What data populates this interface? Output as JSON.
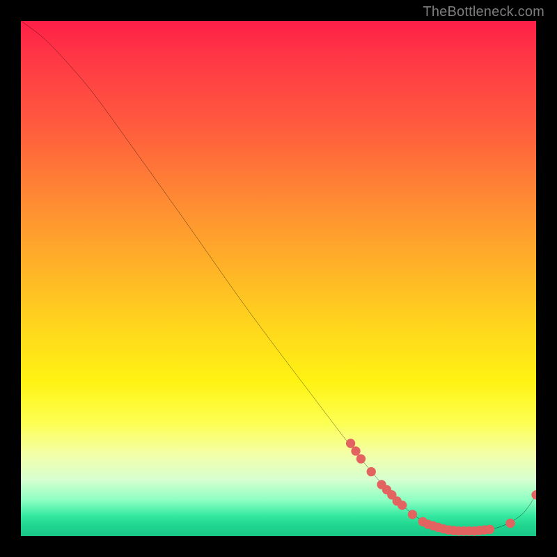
{
  "watermark": "TheBottleneck.com",
  "chart_data": {
    "type": "line",
    "title": "",
    "xlabel": "",
    "ylabel": "",
    "xlim": [
      0,
      100
    ],
    "ylim": [
      0,
      100
    ],
    "curve": [
      {
        "x": 0,
        "y": 100
      },
      {
        "x": 4,
        "y": 97
      },
      {
        "x": 8,
        "y": 93
      },
      {
        "x": 14,
        "y": 86
      },
      {
        "x": 22,
        "y": 75
      },
      {
        "x": 32,
        "y": 61
      },
      {
        "x": 44,
        "y": 44
      },
      {
        "x": 56,
        "y": 28
      },
      {
        "x": 66,
        "y": 15
      },
      {
        "x": 74,
        "y": 6
      },
      {
        "x": 80,
        "y": 2
      },
      {
        "x": 86,
        "y": 1
      },
      {
        "x": 92,
        "y": 1.5
      },
      {
        "x": 97,
        "y": 4
      },
      {
        "x": 100,
        "y": 8
      }
    ],
    "markers": [
      {
        "x": 64,
        "y": 18
      },
      {
        "x": 65,
        "y": 16.5
      },
      {
        "x": 66,
        "y": 15
      },
      {
        "x": 68,
        "y": 12.5
      },
      {
        "x": 70,
        "y": 10
      },
      {
        "x": 71,
        "y": 9
      },
      {
        "x": 72,
        "y": 8
      },
      {
        "x": 73,
        "y": 6.8
      },
      {
        "x": 74,
        "y": 6
      },
      {
        "x": 76,
        "y": 4.2
      },
      {
        "x": 78,
        "y": 2.8
      },
      {
        "x": 79,
        "y": 2.3
      },
      {
        "x": 80,
        "y": 2
      },
      {
        "x": 81,
        "y": 1.7
      },
      {
        "x": 82,
        "y": 1.4
      },
      {
        "x": 83,
        "y": 1.2
      },
      {
        "x": 84,
        "y": 1.1
      },
      {
        "x": 85,
        "y": 1
      },
      {
        "x": 86,
        "y": 1
      },
      {
        "x": 87,
        "y": 1
      },
      {
        "x": 88,
        "y": 1
      },
      {
        "x": 89,
        "y": 1.1
      },
      {
        "x": 90,
        "y": 1.2
      },
      {
        "x": 91,
        "y": 1.3
      },
      {
        "x": 95,
        "y": 2.5
      },
      {
        "x": 100,
        "y": 8
      }
    ],
    "marker_color": "#e2635f",
    "line_color": "#000000",
    "line_width": 2
  }
}
